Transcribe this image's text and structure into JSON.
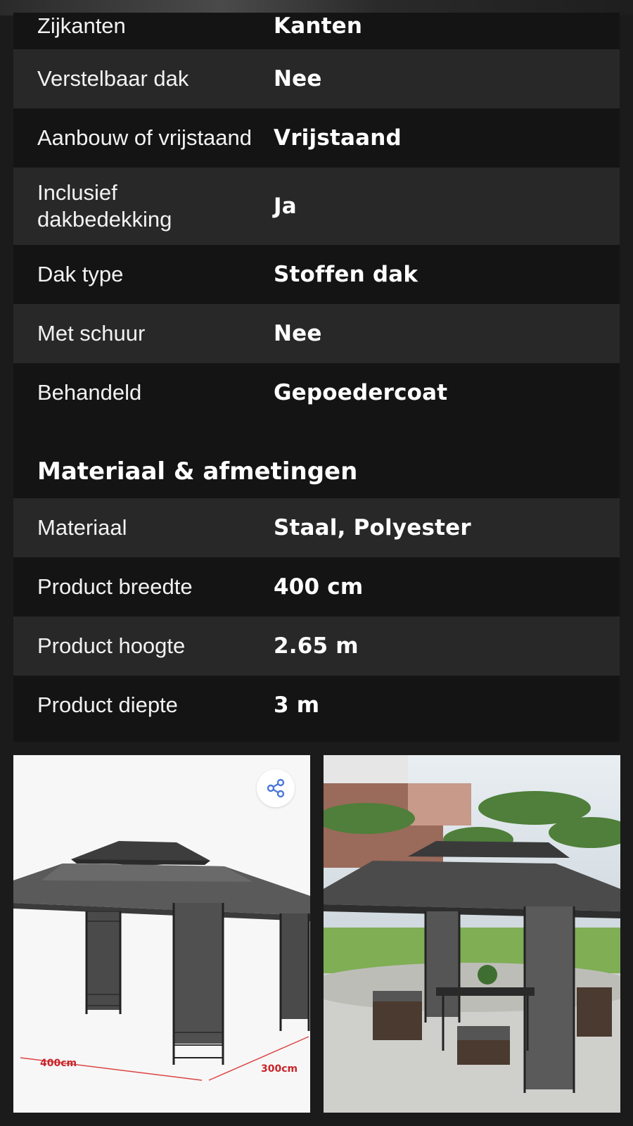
{
  "top_partial": {
    "label": "Zijkanten",
    "value": "Kanten"
  },
  "specs_top": [
    {
      "label": "Verstelbaar dak",
      "value": "Nee"
    },
    {
      "label": "Aanbouw of vrijstaand",
      "value": "Vrijstaand"
    },
    {
      "label": "Inclusief dakbedekking",
      "value": "Ja"
    },
    {
      "label": "Dak type",
      "value": "Stoffen dak"
    },
    {
      "label": "Met schuur",
      "value": "Nee"
    },
    {
      "label": "Behandeld",
      "value": "Gepoedercoat"
    }
  ],
  "section_title": "Materiaal & afmetingen",
  "specs_material": [
    {
      "label": "Materiaal",
      "value": "Staal, Polyester"
    },
    {
      "label": "Product breedte",
      "value": "400 cm"
    },
    {
      "label": "Product hoogte",
      "value": "2.65 m"
    },
    {
      "label": "Product diepte",
      "value": "3 m"
    }
  ],
  "image_left": {
    "dim_width": "400cm",
    "dim_depth": "300cm",
    "share_icon": "share-icon"
  },
  "colors": {
    "row_light": "#282828",
    "row_dark": "#141414",
    "page_bg": "#1b1b1b",
    "share_icon": "#4a78d8",
    "dimension_line": "#c8252b"
  }
}
